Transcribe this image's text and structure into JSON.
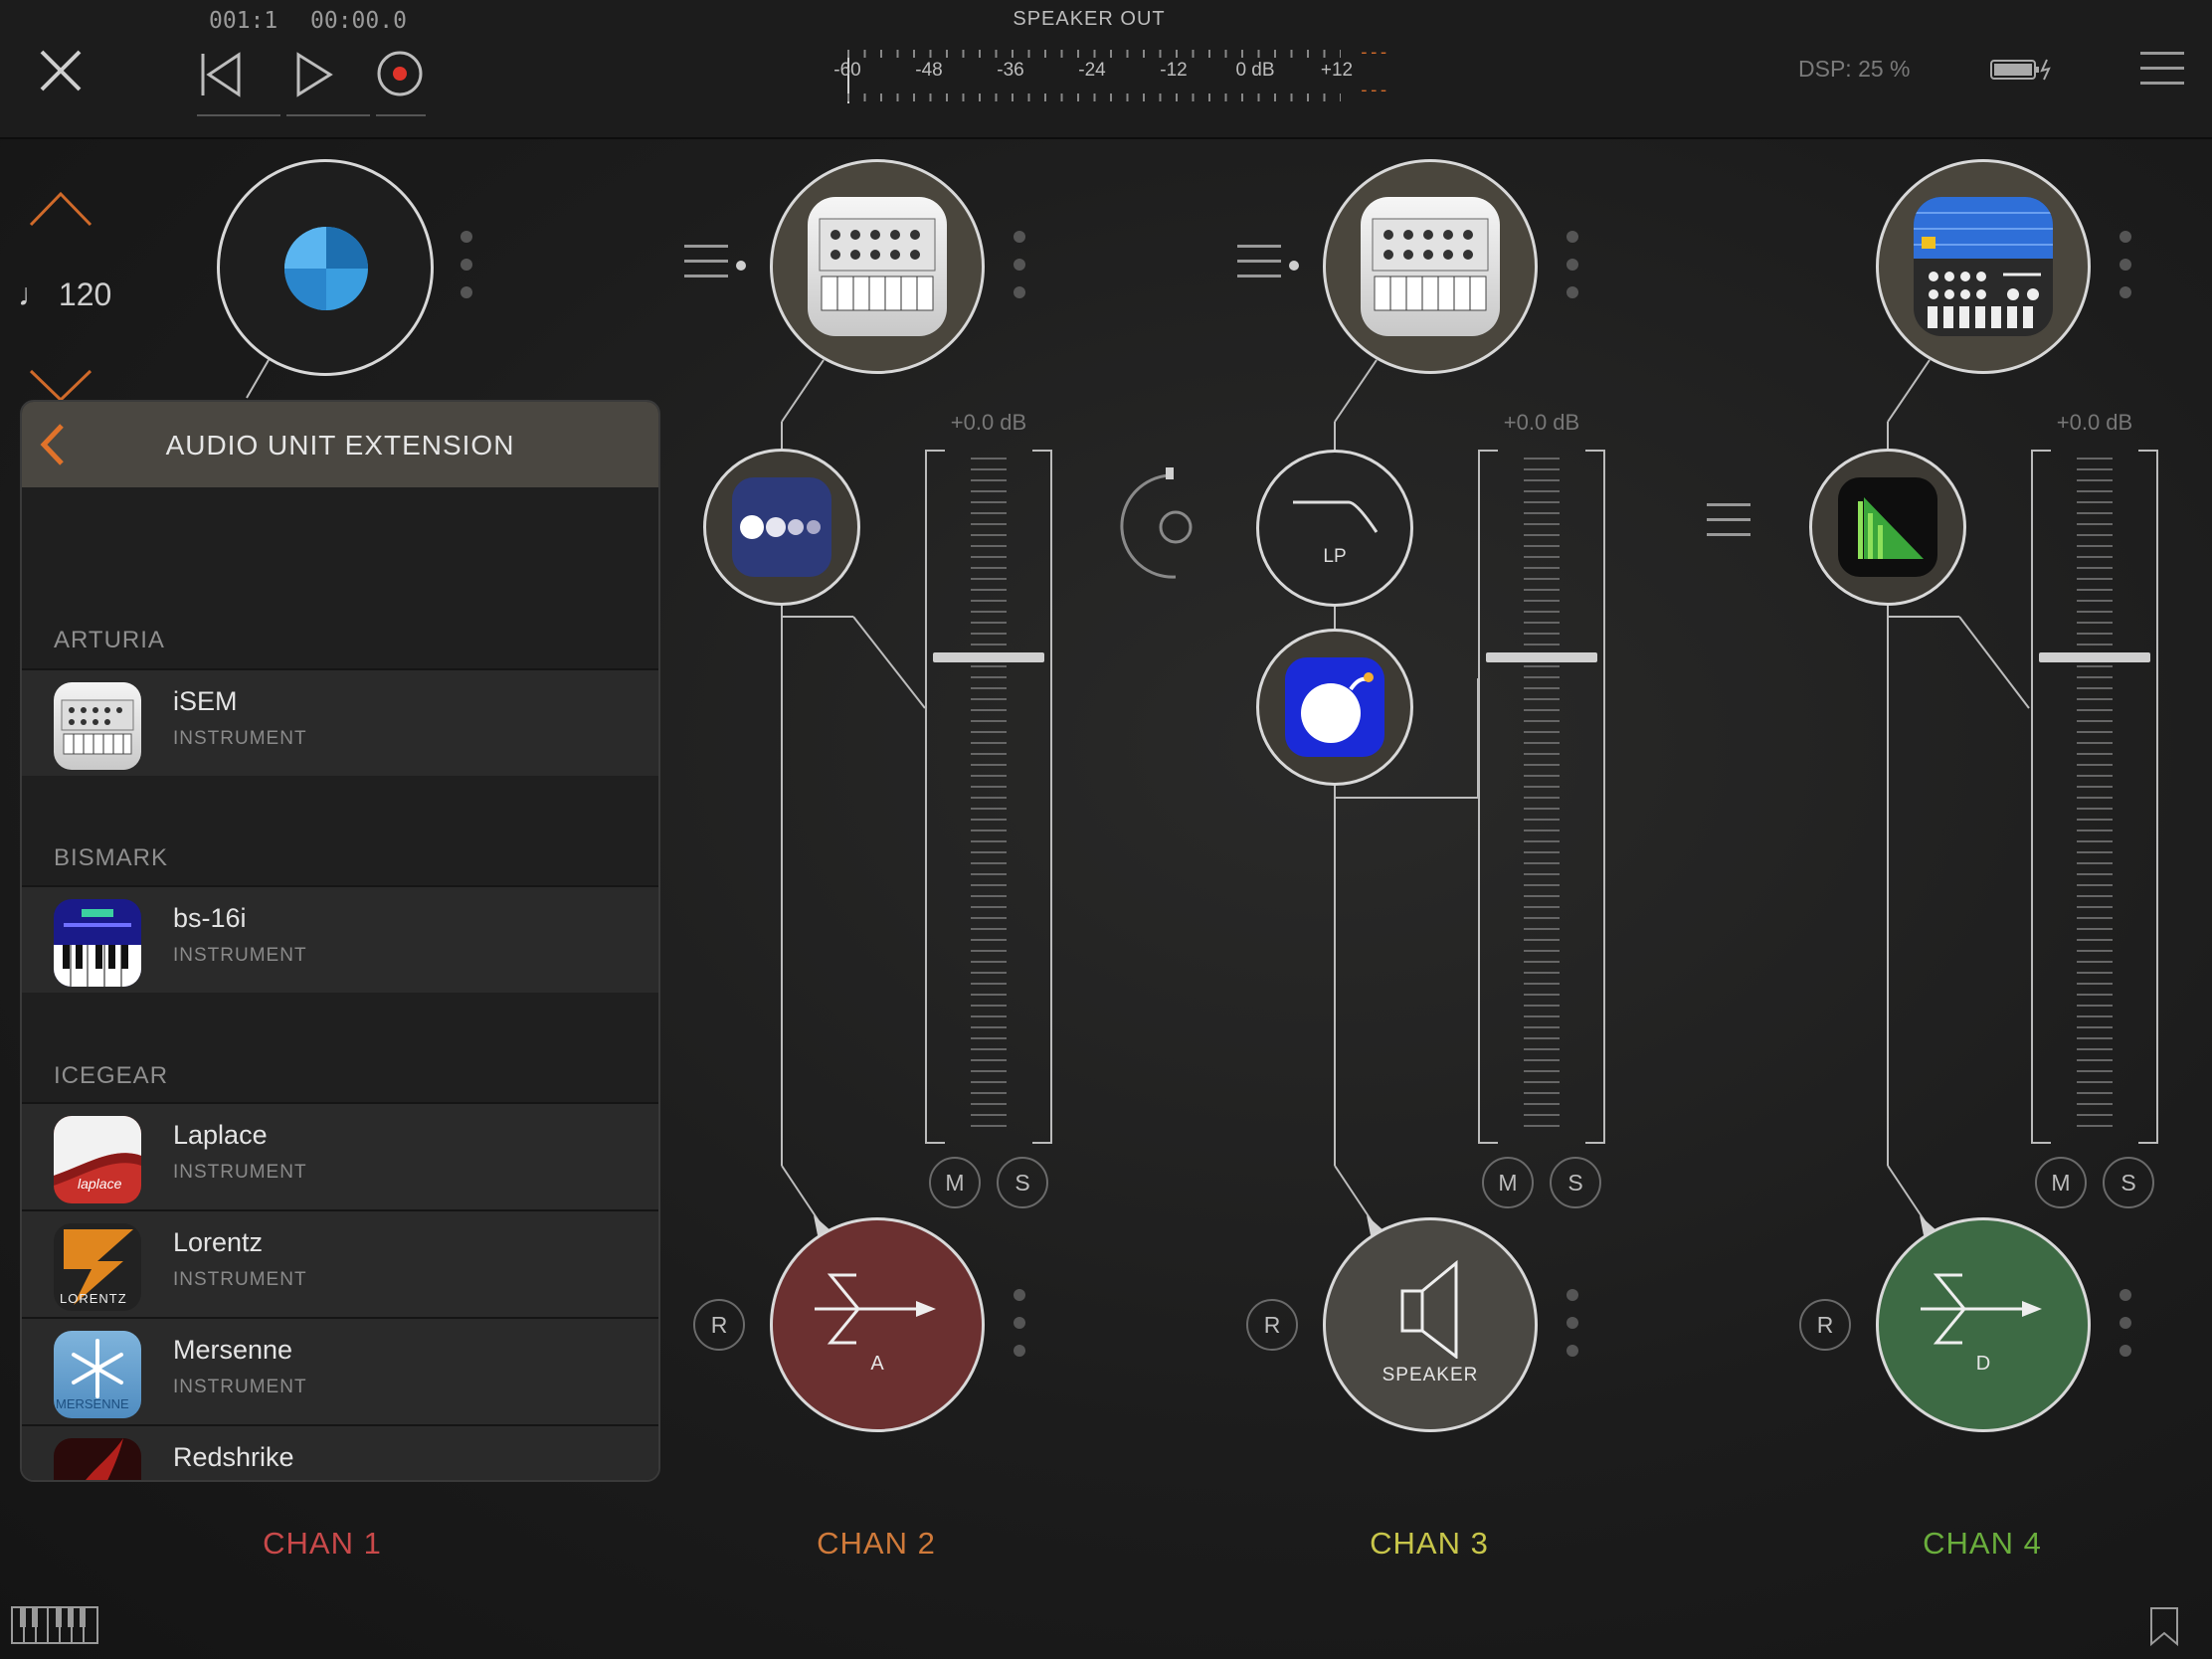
{
  "transport": {
    "position_bars": "001:1",
    "position_time": "00:00.0",
    "close_icon": "close-icon",
    "rewind_icon": "rewind-icon",
    "play_icon": "play-icon",
    "record_icon": "record-icon"
  },
  "meter": {
    "title": "SPEAKER OUT",
    "scale": [
      "-60",
      "-48",
      "-36",
      "-24",
      "-12",
      "0 dB",
      "+12"
    ],
    "peak_top": "---",
    "peak_bottom": "---"
  },
  "status": {
    "dsp": "DSP: 25 %"
  },
  "tempo": {
    "value": "120",
    "note_symbol": "♩"
  },
  "panel": {
    "title": "AUDIO UNIT EXTENSION",
    "sections": [
      {
        "label": "ARTURIA",
        "items": [
          {
            "name": "iSEM",
            "type": "INSTRUMENT"
          }
        ]
      },
      {
        "label": "BISMARK",
        "items": [
          {
            "name": "bs-16i",
            "type": "INSTRUMENT"
          }
        ]
      },
      {
        "label": "ICEGEAR",
        "items": [
          {
            "name": "Laplace",
            "type": "INSTRUMENT"
          },
          {
            "name": "Lorentz",
            "type": "INSTRUMENT"
          },
          {
            "name": "Mersenne",
            "type": "INSTRUMENT"
          },
          {
            "name": "Redshrike",
            "type": ""
          }
        ]
      }
    ],
    "icon_text": {
      "laplace": "laplace",
      "lorentz": "LORENTZ",
      "mersenne": "MERSENNE"
    }
  },
  "channels": [
    {
      "label": "CHAN 1",
      "color": "#c9494a"
    },
    {
      "label": "CHAN 2",
      "color": "#d07a3a",
      "db": "+0.0 dB",
      "mute": "M",
      "solo": "S",
      "record": "R",
      "out_label": "A",
      "out_color": "#6b3030"
    },
    {
      "label": "CHAN 3",
      "color": "#c8c64a",
      "db": "+0.0 dB",
      "mute": "M",
      "solo": "S",
      "record": "R",
      "out_label": "SPEAKER",
      "out_color": "#4a4843",
      "filter_label": "LP"
    },
    {
      "label": "CHAN 4",
      "color": "#6aae3c",
      "db": "+0.0 dB",
      "mute": "M",
      "solo": "S",
      "record": "R",
      "out_label": "D",
      "out_color": "#3d6a44"
    }
  ]
}
